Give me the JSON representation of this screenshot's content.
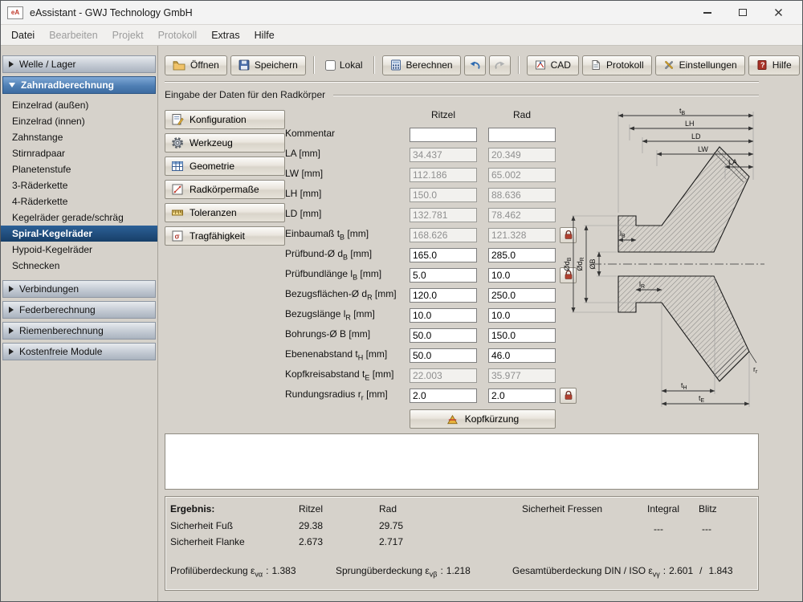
{
  "titlebar": {
    "title": "eAssistant - GWJ Technology GmbH"
  },
  "icons": {
    "app_glyph": "eA",
    "help_glyph": "?",
    "trag_glyph": "σ"
  },
  "menubar": {
    "items": [
      {
        "label": "Datei"
      },
      {
        "label": "Bearbeiten"
      },
      {
        "label": "Projekt"
      },
      {
        "label": "Protokoll"
      },
      {
        "label": "Extras"
      },
      {
        "label": "Hilfe"
      }
    ]
  },
  "sidebar": {
    "sections": [
      {
        "label": "Welle / Lager"
      },
      {
        "label": "Zahnradberechnung",
        "items": [
          "Einzelrad (außen)",
          "Einzelrad (innen)",
          "Zahnstange",
          "Stirnradpaar",
          "Planetenstufe",
          "3-Räderkette",
          "4-Räderkette",
          "Kegelräder gerade/schräg",
          "Spiral-Kegelräder",
          "Hypoid-Kegelräder",
          "Schnecken"
        ],
        "selected": "Spiral-Kegelräder"
      },
      {
        "label": "Verbindungen"
      },
      {
        "label": "Federberechnung"
      },
      {
        "label": "Riemenberechnung"
      },
      {
        "label": "Kostenfreie Module"
      }
    ]
  },
  "toolbar": {
    "open": "Öffnen",
    "save": "Speichern",
    "lokal": "Lokal",
    "calculate": "Berechnen",
    "cad": "CAD",
    "protokoll": "Protokoll",
    "settings": "Einstellungen",
    "help": "Hilfe"
  },
  "page": {
    "section_title": "Eingabe der Daten für den Radkörper"
  },
  "nav_buttons": [
    "Konfiguration",
    "Werkzeug",
    "Geometrie",
    "Radkörpermaße",
    "Toleranzen",
    "Tragfähigkeit"
  ],
  "form": {
    "col_ritzel": "Ritzel",
    "col_rad": "Rad",
    "kopfkuerzung_label": "Kopfkürzung",
    "rows": [
      {
        "pre": "Kommentar",
        "sub": "",
        "post": "",
        "ritzel": "",
        "rad": ""
      },
      {
        "pre": "LA [mm]",
        "sub": "",
        "post": "",
        "ritzel": "34.437",
        "rad": "20.349"
      },
      {
        "pre": "LW [mm]",
        "sub": "",
        "post": "",
        "ritzel": "112.186",
        "rad": "65.002"
      },
      {
        "pre": "LH [mm]",
        "sub": "",
        "post": "",
        "ritzel": "150.0",
        "rad": "88.636"
      },
      {
        "pre": "LD [mm]",
        "sub": "",
        "post": "",
        "ritzel": "132.781",
        "rad": "78.462"
      },
      {
        "pre": "Einbaumaß t",
        "sub": "B",
        "post": " [mm]",
        "ritzel": "168.626",
        "rad": "121.328"
      },
      {
        "pre": "Prüfbund-Ø d",
        "sub": "B",
        "post": " [mm]",
        "ritzel": "165.0",
        "rad": "285.0"
      },
      {
        "pre": "Prüfbundlänge l",
        "sub": "B",
        "post": " [mm]",
        "ritzel": "5.0",
        "rad": "10.0"
      },
      {
        "pre": "Bezugsflächen-Ø d",
        "sub": "R",
        "post": " [mm]",
        "ritzel": "120.0",
        "rad": "250.0"
      },
      {
        "pre": "Bezugslänge l",
        "sub": "R",
        "post": " [mm]",
        "ritzel": "10.0",
        "rad": "10.0"
      },
      {
        "pre": "Bohrungs-Ø B [mm]",
        "sub": "",
        "post": "",
        "ritzel": "50.0",
        "rad": "150.0"
      },
      {
        "pre": "Ebenenabstand t",
        "sub": "H",
        "post": " [mm]",
        "ritzel": "50.0",
        "rad": "46.0"
      },
      {
        "pre": "Kopfkreisabstand t",
        "sub": "E",
        "post": " [mm]",
        "ritzel": "22.003",
        "rad": "35.977"
      },
      {
        "pre": "Rundungsradius r",
        "sub": "r",
        "post": " [mm]",
        "ritzel": "2.0",
        "rad": "2.0"
      }
    ]
  },
  "drawing": {
    "tB": {
      "m": "t",
      "s": "B"
    },
    "LH": {
      "m": "LH",
      "s": ""
    },
    "LD": {
      "m": "LD",
      "s": ""
    },
    "LW": {
      "m": "LW",
      "s": ""
    },
    "LA": {
      "m": "LA",
      "s": ""
    },
    "lB": {
      "m": "l",
      "s": "B"
    },
    "lR": {
      "m": "l",
      "s": "R"
    },
    "dB": {
      "m": "Ød",
      "s": "B"
    },
    "dR": {
      "m": "Ød",
      "s": "R"
    },
    "B": {
      "m": "ØB",
      "s": ""
    },
    "tH": {
      "m": "t",
      "s": "H"
    },
    "tE": {
      "m": "t",
      "s": "E"
    },
    "rr": {
      "m": "r",
      "s": "r"
    }
  },
  "results": {
    "header": "Ergebnis:",
    "cols": {
      "ritzel": "Ritzel",
      "rad": "Rad",
      "fressen": "Sicherheit Fressen",
      "integral": "Integral",
      "blitz": "Blitz"
    },
    "rows": [
      {
        "label": "Sicherheit Fuß",
        "ritzel": "29.38",
        "rad": "29.75"
      },
      {
        "label": "Sicherheit Flanke",
        "ritzel": "2.673",
        "rad": "2.717"
      }
    ],
    "integral_value": "---",
    "blitz_value": "---",
    "profil": {
      "pre": "Profilüberdeckung ε",
      "sub": "vα",
      "colon": ":",
      "value": "1.383"
    },
    "sprung": {
      "pre": "Sprungüberdeckung ε",
      "sub": "vβ",
      "colon": ":",
      "value": "1.218"
    },
    "gesamt": {
      "pre": "Gesamtüberdeckung DIN / ISO ε",
      "sub": "vγ",
      "colon": ":",
      "v1": "2.601",
      "slash": "/",
      "v2": "1.843"
    }
  }
}
